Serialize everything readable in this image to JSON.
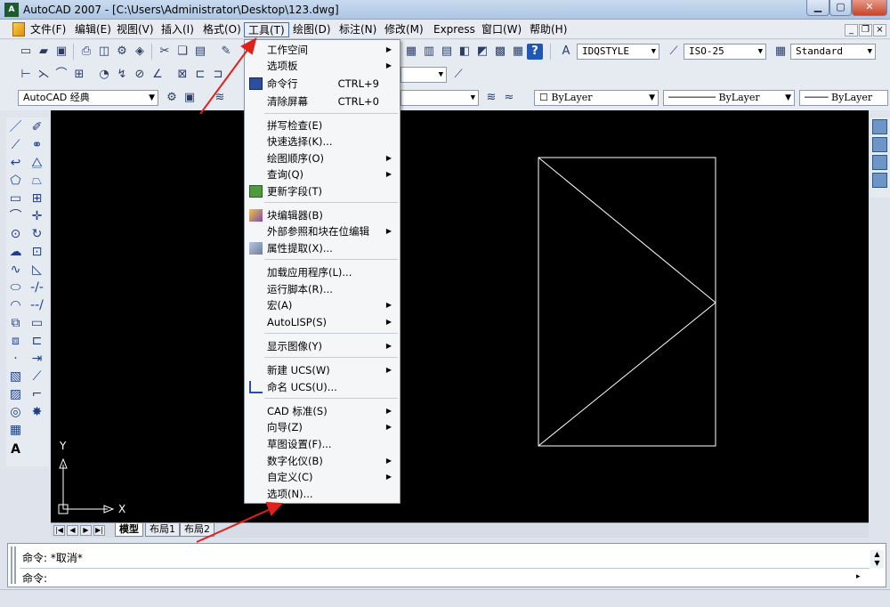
{
  "window": {
    "title": "AutoCAD 2007 - [C:\\Users\\Administrator\\Desktop\\123.dwg]",
    "app_icon": "autocad-icon"
  },
  "menubar": {
    "items": [
      "文件(F)",
      "编辑(E)",
      "视图(V)",
      "插入(I)",
      "格式(O)",
      "工具(T)",
      "绘图(D)",
      "标注(N)",
      "修改(M)",
      "Express",
      "窗口(W)",
      "帮助(H)"
    ],
    "active": "工具(T)"
  },
  "toolbar": {
    "text_style": "IDQSTYLE",
    "dim_style": "ISO-25",
    "table_style": "Standard",
    "workspace": "AutoCAD 经典",
    "color": "ByLayer",
    "linetype": "ByLayer",
    "lineweight": "ByLayer"
  },
  "tools_menu": {
    "items": [
      {
        "label": "工作空间",
        "submenu": true
      },
      {
        "label": "选项板",
        "submenu": true
      },
      {
        "label": "命令行",
        "shortcut": "CTRL+9",
        "icon": "command-line-icon"
      },
      {
        "label": "清除屏幕",
        "shortcut": "CTRL+0"
      },
      {
        "label": "拼写检查(E)"
      },
      {
        "label": "快速选择(K)..."
      },
      {
        "label": "绘图顺序(O)",
        "submenu": true
      },
      {
        "label": "查询(Q)",
        "submenu": true
      },
      {
        "label": "更新字段(T)",
        "icon": "update-field-icon"
      },
      {
        "label": "块编辑器(B)",
        "icon": "block-editor-icon"
      },
      {
        "label": "外部参照和块在位编辑",
        "submenu": true
      },
      {
        "label": "属性提取(X)...",
        "icon": "attribute-extract-icon"
      },
      {
        "label": "加载应用程序(L)..."
      },
      {
        "label": "运行脚本(R)..."
      },
      {
        "label": "宏(A)",
        "submenu": true
      },
      {
        "label": "AutoLISP(S)",
        "submenu": true
      },
      {
        "label": "显示图像(Y)",
        "submenu": true
      },
      {
        "label": "新建 UCS(W)",
        "submenu": true
      },
      {
        "label": "命名 UCS(U)...",
        "icon": "named-ucs-icon"
      },
      {
        "label": "CAD 标准(S)",
        "submenu": true
      },
      {
        "label": "向导(Z)",
        "submenu": true
      },
      {
        "label": "草图设置(F)..."
      },
      {
        "label": "数字化仪(B)",
        "submenu": true
      },
      {
        "label": "自定义(C)",
        "submenu": true
      },
      {
        "label": "选项(N)..."
      }
    ]
  },
  "ucs": {
    "x_label": "X",
    "y_label": "Y"
  },
  "layout_tabs": [
    "模型",
    "布局1",
    "布局2"
  ],
  "active_tab": "模型",
  "command": {
    "line1": "命令: *取消*",
    "line2": "命令:"
  },
  "colors": {
    "canvas": "#000000",
    "drawing_lines": "#ffffff",
    "annotation_arrow": "#e0201a"
  }
}
